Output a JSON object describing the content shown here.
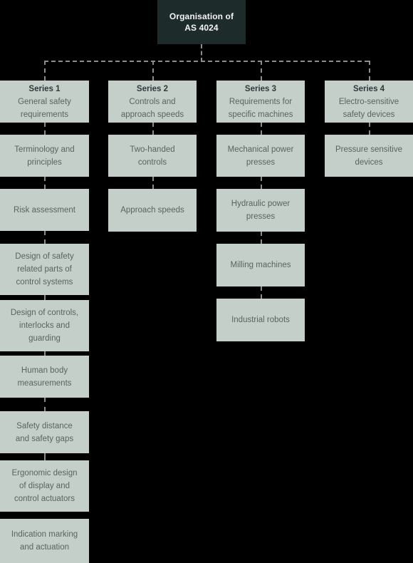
{
  "title": {
    "line1": "Organisation of",
    "line2": "AS 4024",
    "text": "Organisation of AS 4024"
  },
  "colors": {
    "background": "#000000",
    "root_box": "#1d2b2a",
    "root_text": "#f2f5f4",
    "node_box": "#c4cfca",
    "node_text": "#59635f",
    "node_heading_text": "#2d3a39",
    "connector": "#8c8c8c"
  },
  "columns": [
    {
      "id": "series-1",
      "header": {
        "series": "Series 1",
        "description_line1": "General safety",
        "description_line2": "requirements",
        "description": "General safety requirements"
      },
      "items": [
        {
          "text": "Terminology and principles",
          "lines": [
            "Terminology and",
            "principles"
          ]
        },
        {
          "text": "Risk assessment",
          "lines": [
            "Risk assessment"
          ]
        },
        {
          "text": "Design of safety related parts of control systems",
          "lines": [
            "Design of safety",
            "related parts of",
            "control systems"
          ]
        },
        {
          "text": "Design of controls, interlocks and guarding",
          "lines": [
            "Design of controls,",
            "interlocks and",
            "guarding"
          ]
        },
        {
          "text": "Human body measurements",
          "lines": [
            "Human body",
            "measurements"
          ]
        },
        {
          "text": "Safety distance and safety gaps",
          "lines": [
            "Safety distance",
            "and safety gaps"
          ]
        },
        {
          "text": "Ergonomic design of display and control actuators",
          "lines": [
            "Ergonomic design",
            "of display and",
            "control actuators"
          ]
        },
        {
          "text": "Indication marking and actuation",
          "lines": [
            "Indication marking",
            "and actuation"
          ]
        }
      ]
    },
    {
      "id": "series-2",
      "header": {
        "series": "Series 2",
        "description_line1": "Controls and",
        "description_line2": "approach speeds",
        "description": "Controls and approach speeds"
      },
      "items": [
        {
          "text": "Two-handed controls",
          "lines": [
            "Two-handed",
            "controls"
          ]
        },
        {
          "text": "Approach speeds",
          "lines": [
            "Approach speeds"
          ]
        }
      ]
    },
    {
      "id": "series-3",
      "header": {
        "series": "Series 3",
        "description_line1": "Requirements for",
        "description_line2": "specific machines",
        "description": "Requirements for specific machines"
      },
      "items": [
        {
          "text": "Mechanical power presses",
          "lines": [
            "Mechanical power",
            "presses"
          ]
        },
        {
          "text": "Hydraulic power presses",
          "lines": [
            "Hydraulic power",
            "presses"
          ]
        },
        {
          "text": "Milling machines",
          "lines": [
            "Milling machines"
          ]
        },
        {
          "text": "Industrial robots",
          "lines": [
            "Industrial robots"
          ]
        }
      ]
    },
    {
      "id": "series-4",
      "header": {
        "series": "Series 4",
        "description_line1": "Electro-sensitive",
        "description_line2": "safety devices",
        "description": "Electro-sensitive safety devices"
      },
      "items": [
        {
          "text": "Pressure sensitive devices",
          "lines": [
            "Pressure sensitive",
            "devices"
          ]
        }
      ]
    }
  ]
}
